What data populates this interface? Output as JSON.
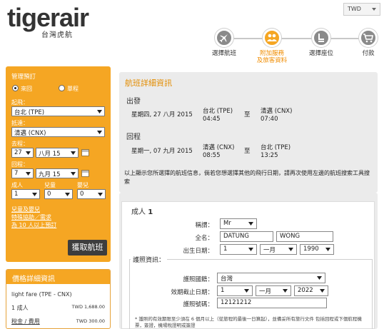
{
  "header": {
    "logo_text": "tigerair",
    "logo_sub": "台灣虎航",
    "currency": "TWD"
  },
  "steps": [
    {
      "label": "選擇航班",
      "icon": "airplane-icon",
      "active": false
    },
    {
      "label": "附加服務\n及旅客資料",
      "icon": "passengers-icon",
      "active": true
    },
    {
      "label": "選擇座位",
      "icon": "seat-icon",
      "active": false
    },
    {
      "label": "付款",
      "icon": "cart-icon",
      "active": false
    }
  ],
  "sidebar": {
    "title": "管理預訂",
    "trip_round": "來回",
    "trip_oneway": "單程",
    "from_label": "起飛：",
    "from_value": "台北 (TPE)",
    "to_label": "抵達：",
    "to_value": "清邁 (CNX)",
    "depart_label": "去程：",
    "depart_day": "27",
    "depart_month": "八月 15",
    "return_label": "回程：",
    "return_day": "7",
    "return_month": "九月 15",
    "adult_label": "成人",
    "child_label": "兒童",
    "infant_label": "嬰兒",
    "adult_value": "1",
    "child_value": "0",
    "infant_value": "0",
    "link_infant": "兒童及嬰兒",
    "link_special": "特殊協助／需求",
    "link_group": "為 10 人以上預訂",
    "search_button": "獲取航班"
  },
  "price": {
    "title": "價格詳細資訊",
    "fare_label": "light fare (TPE - CNX)",
    "adult_row": "1 成人",
    "adult_amount": "TWD 1,688.00",
    "tax_label": "稅金 / 費用",
    "tax_amount": "TWD 300.00"
  },
  "flight": {
    "title": "航班詳細資訊",
    "outbound_label": "出發",
    "outbound_date": "星期四, 27 八月 2015",
    "outbound_from": "台北 (TPE)",
    "outbound_from_time": "04:45",
    "outbound_to_word": "至",
    "outbound_to": "清邁 (CNX)",
    "outbound_to_time": "07:40",
    "inbound_label": "回程",
    "inbound_date": "星期一, 07 九月 2015",
    "inbound_from": "清邁 (CNX)",
    "inbound_from_time": "08:55",
    "inbound_to_word": "至",
    "inbound_to": "台北 (TPE)",
    "inbound_to_time": "13:25",
    "note": "以上顯示您所選擇的航班信息，倘若您想選擇其他的飛行日期，請再次使用左邊的航班搜索工具搜索"
  },
  "passenger": {
    "title_prefix": "成人",
    "title_number": "1",
    "honorific_label": "稱謂：",
    "honorific_value": "Mr",
    "name_label": "全名：",
    "first_name": "DATUNG",
    "last_name": "WONG",
    "dob_label": "出生日期：",
    "dob_day": "1",
    "dob_month": "一月",
    "dob_year": "1990",
    "passport_section": "護照資訊：",
    "nationality_label": "護照國籍：",
    "nationality_value": "台灣",
    "expiry_label": "效期截止日期：",
    "expiry_day": "1",
    "expiry_month": "一月",
    "expiry_year": "2022",
    "passport_no_label": "護照號碼：",
    "passport_no_value": "12121212",
    "passport_note": "* 護照的有效期限至少須在 6 個月以上（從旅程的最後一日算起），並備妥所有旅行文件 包括回程或下個航程機票，簽證，機場稅證明或簽證"
  }
}
